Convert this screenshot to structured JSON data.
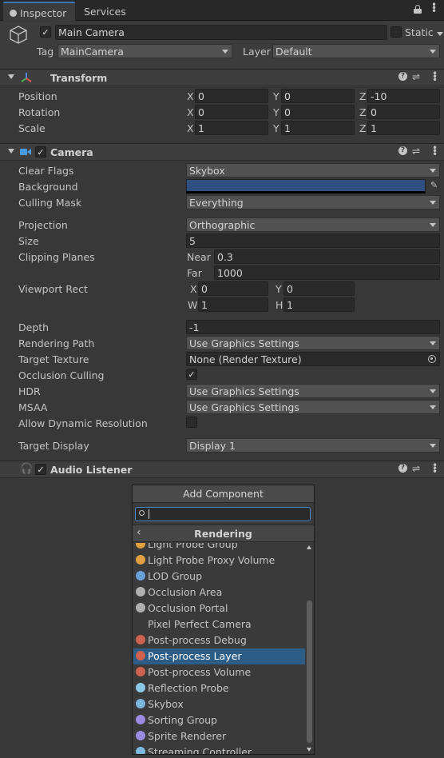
{
  "tabs": {
    "inspector": "Inspector",
    "services": "Services",
    "info_icon": "info-icon",
    "lock_icon": "lock-icon",
    "menu_icon": "kebab-menu-icon"
  },
  "gameobject": {
    "name": "Main Camera",
    "static_label": "Static",
    "tag_label": "Tag",
    "tag_value": "MainCamera",
    "layer_label": "Layer",
    "layer_value": "Default",
    "active_check": "✓"
  },
  "transform": {
    "title": "Transform",
    "position": {
      "label": "Position",
      "x": "0",
      "y": "0",
      "z": "-10"
    },
    "rotation": {
      "label": "Rotation",
      "x": "0",
      "y": "0",
      "z": "0"
    },
    "scale": {
      "label": "Scale",
      "x": "1",
      "y": "1",
      "z": "1"
    }
  },
  "axes": {
    "x": "X",
    "y": "Y",
    "z": "Z",
    "w": "W",
    "h": "H"
  },
  "camera": {
    "title": "Camera",
    "clear_flags": {
      "label": "Clear Flags",
      "value": "Skybox"
    },
    "background": {
      "label": "Background",
      "color": "#2f4f80"
    },
    "culling_mask": {
      "label": "Culling Mask",
      "value": "Everything"
    },
    "projection": {
      "label": "Projection",
      "value": "Orthographic"
    },
    "size": {
      "label": "Size",
      "value": "5"
    },
    "clipping": {
      "label": "Clipping Planes",
      "near_label": "Near",
      "near": "0.3",
      "far_label": "Far",
      "far": "1000"
    },
    "viewport": {
      "label": "Viewport Rect",
      "x": "0",
      "y": "0",
      "w": "1",
      "h": "1"
    },
    "depth": {
      "label": "Depth",
      "value": "-1"
    },
    "rendering_path": {
      "label": "Rendering Path",
      "value": "Use Graphics Settings"
    },
    "target_texture": {
      "label": "Target Texture",
      "value": "None (Render Texture)"
    },
    "occlusion_culling": {
      "label": "Occlusion Culling",
      "check": "✓"
    },
    "hdr": {
      "label": "HDR",
      "value": "Use Graphics Settings"
    },
    "msaa": {
      "label": "MSAA",
      "value": "Use Graphics Settings"
    },
    "dynamic_resolution": {
      "label": "Allow Dynamic Resolution"
    },
    "target_display": {
      "label": "Target Display",
      "value": "Display 1"
    }
  },
  "audio": {
    "title": "Audio Listener"
  },
  "add_component": {
    "button": "Add Component",
    "search_value": "",
    "category": "Rendering",
    "back_glyph": "‹",
    "cut_item": "Light Probe Group",
    "items": [
      {
        "label": "Light Probe Proxy Volume",
        "icon": "light-probe-proxy-icon",
        "color": "#e0a040"
      },
      {
        "label": "LOD Group",
        "icon": "lod-group-icon",
        "color": "#6aa0d8"
      },
      {
        "label": "Occlusion Area",
        "icon": "occlusion-area-icon",
        "color": "#b0b0b0"
      },
      {
        "label": "Occlusion Portal",
        "icon": "occlusion-portal-icon",
        "color": "#b0b0b0"
      },
      {
        "label": "Pixel Perfect Camera",
        "icon": "",
        "color": ""
      },
      {
        "label": "Post-process Debug",
        "icon": "post-process-icon",
        "color": "#d06050"
      },
      {
        "label": "Post-process Layer",
        "icon": "post-process-icon",
        "color": "#d06050"
      },
      {
        "label": "Post-process Volume",
        "icon": "post-process-icon",
        "color": "#d06050"
      },
      {
        "label": "Reflection Probe",
        "icon": "reflection-probe-icon",
        "color": "#8cc8e8"
      },
      {
        "label": "Skybox",
        "icon": "skybox-icon",
        "color": "#7ab8e0"
      },
      {
        "label": "Sorting Group",
        "icon": "sorting-group-icon",
        "color": "#9a8ae0"
      },
      {
        "label": "Sprite Renderer",
        "icon": "sprite-renderer-icon",
        "color": "#9a8ae0"
      },
      {
        "label": "Streaming Controller",
        "icon": "streaming-controller-icon",
        "color": "#7ab8e0"
      }
    ],
    "selected_label": "Post-process Layer"
  }
}
